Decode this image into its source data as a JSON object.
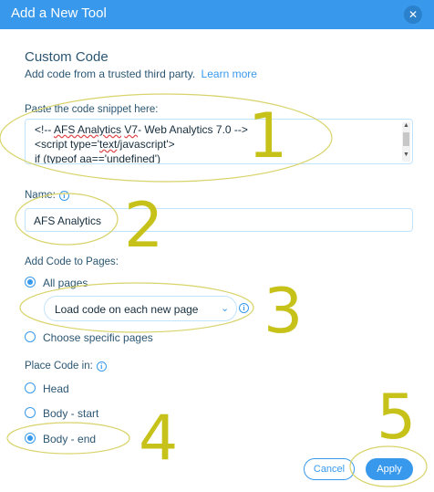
{
  "dialog": {
    "title": "Add a New Tool",
    "close_glyph": "✕"
  },
  "section": {
    "title": "Custom Code",
    "subtitle": "Add code from a trusted third party.",
    "learn_more": "Learn more"
  },
  "code": {
    "label": "Paste the code snippet here:",
    "line1_pre": "<!-- ",
    "line1_ul1": "AFS Analytics",
    "line1_mid": " ",
    "line1_ul2": "V7",
    "line1_post": "- Web Analytics 7.0 -->",
    "line2_pre": "<script type='",
    "line2_ul": "text",
    "line2_post": "/javascript'>",
    "line3": "if (typeof aa=='undefined')"
  },
  "name_field": {
    "label": "Name:",
    "value": "AFS Analytics"
  },
  "pages": {
    "label": "Add Code to Pages:",
    "options": [
      "All pages",
      "Choose specific pages"
    ],
    "selected": "All pages",
    "load_select_value": "Load code on each new page"
  },
  "placement": {
    "label": "Place Code in:",
    "options": [
      "Head",
      "Body - start",
      "Body - end"
    ],
    "selected": "Body - end"
  },
  "buttons": {
    "cancel": "Cancel",
    "apply": "Apply"
  },
  "annotations": {
    "n1": "1",
    "n2": "2",
    "n3": "3",
    "n4": "4",
    "n5": "5",
    "color": "#c7c21a"
  },
  "colors": {
    "accent": "#3899ec",
    "text": "#2b5672",
    "header": "#3899ec"
  },
  "icons": {
    "info": "info-icon",
    "chevron": "chevron-down-icon",
    "close": "close-icon"
  }
}
